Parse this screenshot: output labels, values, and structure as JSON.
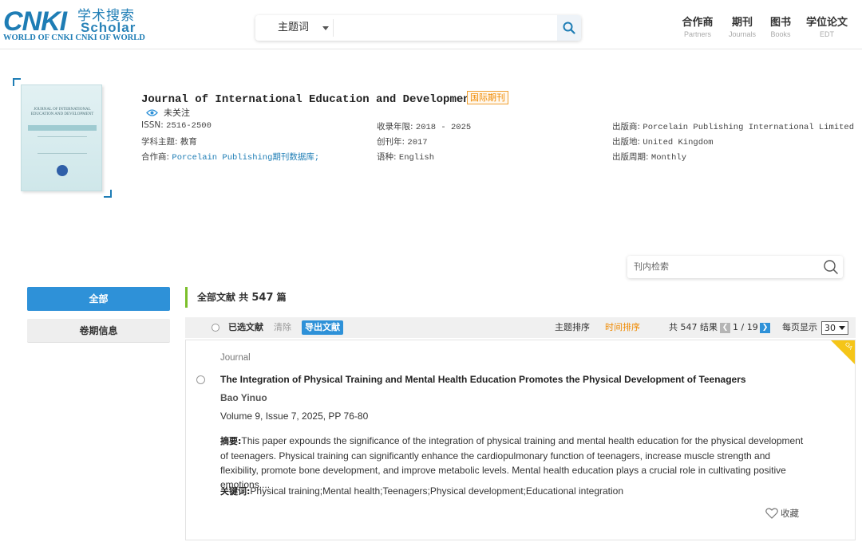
{
  "header": {
    "logo_main": "CNKI",
    "logo_cn": "学术搜索",
    "logo_scholar": "Scholar",
    "logo_sub": "WORLD OF CNKI CNKI OF WORLD",
    "search_type": "主题词",
    "search_placeholder": "",
    "nav": [
      {
        "cn": "合作商",
        "en": "Partners"
      },
      {
        "cn": "期刊",
        "en": "Journals"
      },
      {
        "cn": "图书",
        "en": "Books"
      },
      {
        "cn": "学位论文",
        "en": "EDT"
      }
    ]
  },
  "journal": {
    "title": "Journal of International Education and Development",
    "badge": "国际期刊",
    "follow": "未关注",
    "issn_label": "ISSN:",
    "issn": "2516-2500",
    "subject_label": "学科主题:",
    "subject": "教育",
    "partner_label": "合作商:",
    "partner": "Porcelain Publishing期刊数据库;",
    "years_label": "收录年限:",
    "years": "2018 - 2025",
    "founded_label": "创刊年:",
    "founded": "2017",
    "lang_label": "语种:",
    "lang": "English",
    "publisher_label": "出版商:",
    "publisher": "Porcelain Publishing International Limited",
    "place_label": "出版地:",
    "place": "United Kingdom",
    "cycle_label": "出版周期:",
    "cycle": "Monthly",
    "cover_text": "JOURNAL OF INTERNATIONAL EDUCATION AND DEVELOPMENT"
  },
  "inner_search": {
    "placeholder": "刊内检索"
  },
  "sidebar": {
    "all": "全部",
    "volumes": "卷期信息"
  },
  "results": {
    "title_prefix": "全部文献 共 ",
    "count": "547",
    "title_suffix": " 篇"
  },
  "toolbar": {
    "selected": "已选文献",
    "clear": "清除",
    "export": "导出文献",
    "sort_topic": "主题排序",
    "sort_time": "时间排序",
    "total": "共 547 结果",
    "page": "1 / 19",
    "per_page_label": "每页显示",
    "per_page": "30"
  },
  "article": {
    "source": "Journal",
    "title": "The Integration of Physical Training and Mental Health Education Promotes the Physical Development of Teenagers",
    "author": "Bao Yinuo",
    "volume": "Volume 9, Issue 7, 2025, PP 76-80",
    "abstract_label": "摘要:",
    "abstract": "This paper expounds the significance of the integration of physical training and mental health education for the physical development of teenagers. Physical training can significantly enhance the cardiopulmonary function of teenagers, increase muscle strength and flexibility, promote bone development, and improve metabolic levels. Mental health education plays a crucial role in cultivating positive emotions,...",
    "keywords_label": "关键词:",
    "keywords": "Physical training;Mental health;Teenagers;Physical development;Educational integration",
    "oa": "OA",
    "favorite": "收藏"
  },
  "colors": {
    "brand": "#1e7db5",
    "primary_button": "#2e91d8",
    "accent_green": "#7cbf2b",
    "sort_active": "#f08a00",
    "oa_badge": "#f5c518"
  }
}
